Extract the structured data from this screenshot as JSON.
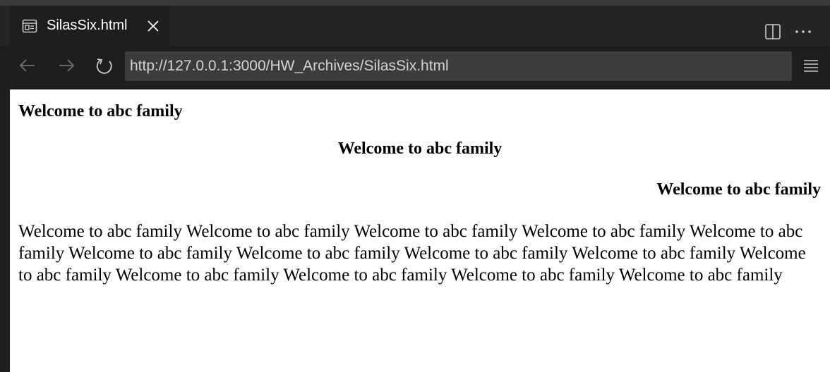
{
  "tab": {
    "title": "SilasSix.html",
    "icon": "preview-icon",
    "close_icon": "close-icon"
  },
  "toolbar": {
    "url": "http://127.0.0.1:3000/HW_Archives/SilasSix.html",
    "back_icon": "arrow-left-icon",
    "forward_icon": "arrow-right-icon",
    "reload_icon": "reload-icon",
    "menu_icon": "hamburger-menu-icon"
  },
  "window_actions": {
    "split_icon": "split-editor-icon",
    "more_icon": "more-actions-icon"
  },
  "page": {
    "heading_left": "Welcome to abc family",
    "heading_center": "Welcome to abc family",
    "heading_right": "Welcome to abc family",
    "paragraph": "Welcome to abc family Welcome to abc family Welcome to abc family Welcome to abc family Welcome to abc family Welcome to abc family Welcome to abc family Welcome to abc family Welcome to abc family Welcome to abc family Welcome to abc family Welcome to abc family Welcome to abc family Welcome to abc family"
  },
  "colors": {
    "chrome_bg": "#1e1e1e",
    "tabbar_bg": "#252526",
    "url_bg": "#3c3c3c",
    "content_bg": "#ffffff"
  }
}
